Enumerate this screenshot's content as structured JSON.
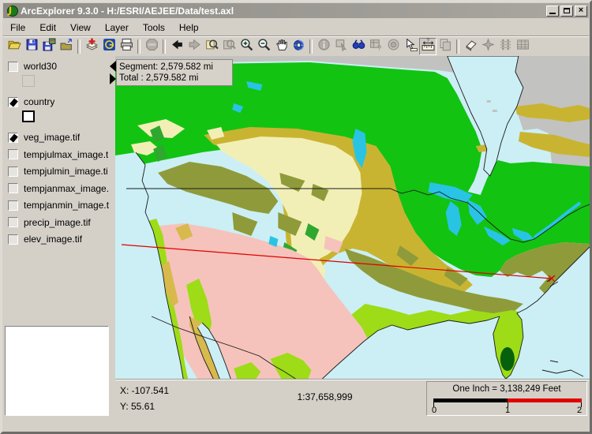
{
  "window": {
    "title": "ArcExplorer 9.3.0 - H:/ESRI/AEJEE/Data/test.axl"
  },
  "menu": {
    "items": [
      "File",
      "Edit",
      "View",
      "Layer",
      "Tools",
      "Help"
    ]
  },
  "toolbar": {
    "buttons": [
      {
        "name": "open-project",
        "enabled": true
      },
      {
        "name": "save",
        "enabled": true
      },
      {
        "name": "save-as",
        "enabled": true
      },
      {
        "name": "export-folder",
        "enabled": true
      },
      {
        "sep": true
      },
      {
        "name": "add-layers",
        "enabled": true
      },
      {
        "name": "geography-network",
        "enabled": true
      },
      {
        "name": "print",
        "enabled": true
      },
      {
        "sep": true
      },
      {
        "name": "stop",
        "enabled": false
      },
      {
        "sep": true
      },
      {
        "name": "back",
        "enabled": true
      },
      {
        "name": "forward",
        "enabled": false
      },
      {
        "name": "zoom-full-extent",
        "enabled": true
      },
      {
        "name": "zoom-active-layer",
        "enabled": false
      },
      {
        "name": "zoom-in",
        "enabled": true
      },
      {
        "name": "zoom-out",
        "enabled": true
      },
      {
        "name": "pan",
        "enabled": true
      },
      {
        "name": "pan-one",
        "enabled": true
      },
      {
        "sep": true
      },
      {
        "name": "identify",
        "enabled": false
      },
      {
        "name": "select-features",
        "enabled": false
      },
      {
        "name": "find",
        "enabled": true
      },
      {
        "name": "query-builder",
        "enabled": false
      },
      {
        "name": "buffer",
        "enabled": false
      },
      {
        "name": "select-tool",
        "enabled": true
      },
      {
        "name": "measure",
        "enabled": true,
        "pressed": true
      },
      {
        "name": "copy-map",
        "enabled": false
      },
      {
        "sep": true
      },
      {
        "name": "eraser",
        "enabled": true
      },
      {
        "name": "clear-selection",
        "enabled": false
      },
      {
        "name": "overview-rails",
        "enabled": false
      },
      {
        "name": "attribute-table",
        "enabled": false
      }
    ]
  },
  "sidebar": {
    "layers": [
      {
        "label": "world30",
        "checked": false,
        "legend": "outline-faint"
      },
      {
        "label": "country",
        "checked": true,
        "legend": "outline-black"
      },
      {
        "label": "veg_image.tif",
        "checked": true
      },
      {
        "label": "tempjulmax_image.t",
        "checked": false
      },
      {
        "label": "tempjulmin_image.ti",
        "checked": false
      },
      {
        "label": "tempjanmax_image.",
        "checked": false
      },
      {
        "label": "tempjanmin_image.t",
        "checked": false
      },
      {
        "label": "precip_image.tif",
        "checked": false
      },
      {
        "label": "elev_image.tif",
        "checked": false
      }
    ]
  },
  "map": {
    "measure": {
      "segment_text": "Segment: 2,579.582 mi",
      "total_text": "Total : 2,579.582 mi"
    },
    "legend_colors": {
      "water": "#CBEFF5",
      "no_data_gray": "#C2C2C0",
      "boreal_green": "#12C312",
      "steppe_olive": "#C9B432",
      "grassland_pale_yellow": "#F2EFB6",
      "woodland_dark_olive": "#8F9B3A",
      "conifer_green": "#2FA82F",
      "desert_pink": "#F5C3BB",
      "broadleaf_yellow_green": "#9DDC17",
      "chaparral_tan": "#D8B94D",
      "lakes_cyan": "#29C4E4",
      "wetland_dark_green": "#07610C",
      "measure_line_red": "#E00000",
      "border_black": "#1A1A1A"
    }
  },
  "status_bar": {
    "x_text": "X: -107.541",
    "y_text": "Y: 55.61",
    "scale_ratio": "1:37,658,999",
    "scale_bar": {
      "label": "One Inch = 3,138,249 Feet",
      "ticks": [
        "0",
        "1",
        "2"
      ]
    }
  }
}
